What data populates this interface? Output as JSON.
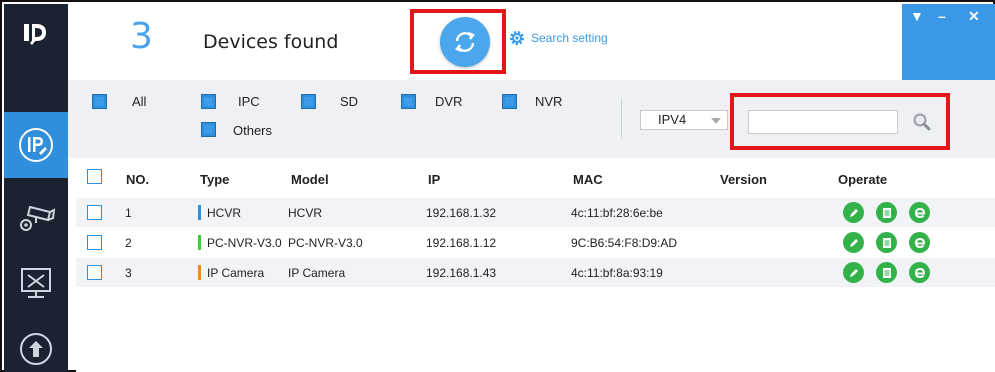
{
  "header": {
    "device_count": "3",
    "found_label": "Devices found",
    "search_setting_label": "Search setting",
    "window_controls": [
      "▼",
      "–",
      "✕"
    ]
  },
  "filters": {
    "items": [
      {
        "label": "All"
      },
      {
        "label": "IPC"
      },
      {
        "label": "SD"
      },
      {
        "label": "DVR"
      },
      {
        "label": "NVR"
      },
      {
        "label": "Others"
      }
    ],
    "ip_version": "IPV4",
    "search_value": ""
  },
  "table": {
    "columns": [
      "NO.",
      "Type",
      "Model",
      "IP",
      "MAC",
      "Version",
      "Operate"
    ],
    "rows": [
      {
        "no": "1",
        "type": "HCVR",
        "type_color": "#2e8fdc",
        "model": "HCVR",
        "ip": "192.168.1.32",
        "mac": "4c:11:bf:28:6e:be",
        "version": ""
      },
      {
        "no": "2",
        "type": "PC-NVR-V3.0",
        "type_color": "#3ccf3c",
        "model": "PC-NVR-V3.0",
        "ip": "192.168.1.12",
        "mac": "9C:B6:54:F8:D9:AD",
        "version": ""
      },
      {
        "no": "3",
        "type": "IP Camera",
        "type_color": "#f08a24",
        "model": "IP Camera",
        "ip": "192.168.1.43",
        "mac": "4c:11:bf:8a:93:19",
        "version": ""
      }
    ]
  },
  "icons": {
    "sidebar": [
      "app-logo-icon",
      "ip-config-icon",
      "camera-settings-icon",
      "tools-icon",
      "upgrade-icon"
    ],
    "operate": [
      "edit-icon",
      "details-icon",
      "web-browser-icon"
    ]
  },
  "colors": {
    "sidebar_bg": "#1b2230",
    "accent": "#2f8fdc",
    "highlight_border": "#e2161b",
    "operate_green": "#33b24a"
  }
}
